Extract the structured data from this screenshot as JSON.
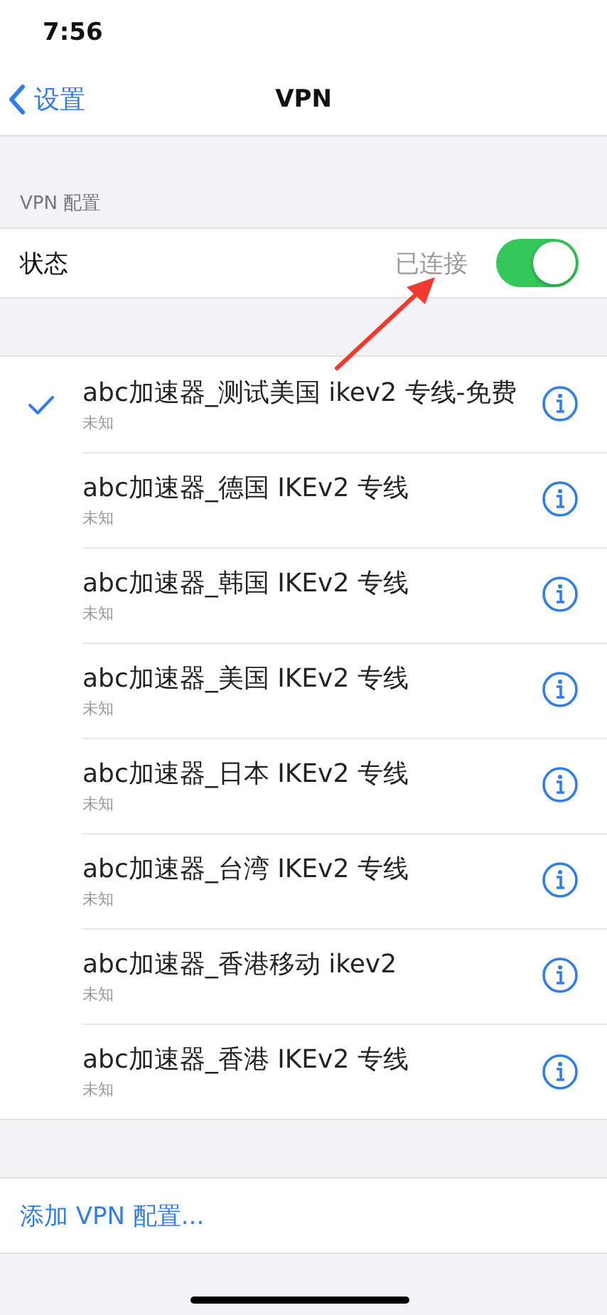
{
  "status_bar": {
    "time": "7:56"
  },
  "nav": {
    "back": "设置",
    "title": "VPN"
  },
  "section_header": "VPN 配置",
  "status_row": {
    "label": "状态",
    "value": "已连接",
    "on": true
  },
  "vpn_list": [
    {
      "name": "abc加速器_测试美国 ikev2 专线-免费",
      "status": "未知",
      "selected": true
    },
    {
      "name": "abc加速器_德国 IKEv2 专线",
      "status": "未知",
      "selected": false
    },
    {
      "name": "abc加速器_韩国 IKEv2 专线",
      "status": "未知",
      "selected": false
    },
    {
      "name": "abc加速器_美国 IKEv2 专线",
      "status": "未知",
      "selected": false
    },
    {
      "name": "abc加速器_日本 IKEv2 专线",
      "status": "未知",
      "selected": false
    },
    {
      "name": "abc加速器_台湾 IKEv2 专线",
      "status": "未知",
      "selected": false
    },
    {
      "name": "abc加速器_香港移动 ikev2",
      "status": "未知",
      "selected": false
    },
    {
      "name": "abc加速器_香港 IKEv2 专线",
      "status": "未知",
      "selected": false
    }
  ],
  "add_button": "添加 VPN 配置..."
}
